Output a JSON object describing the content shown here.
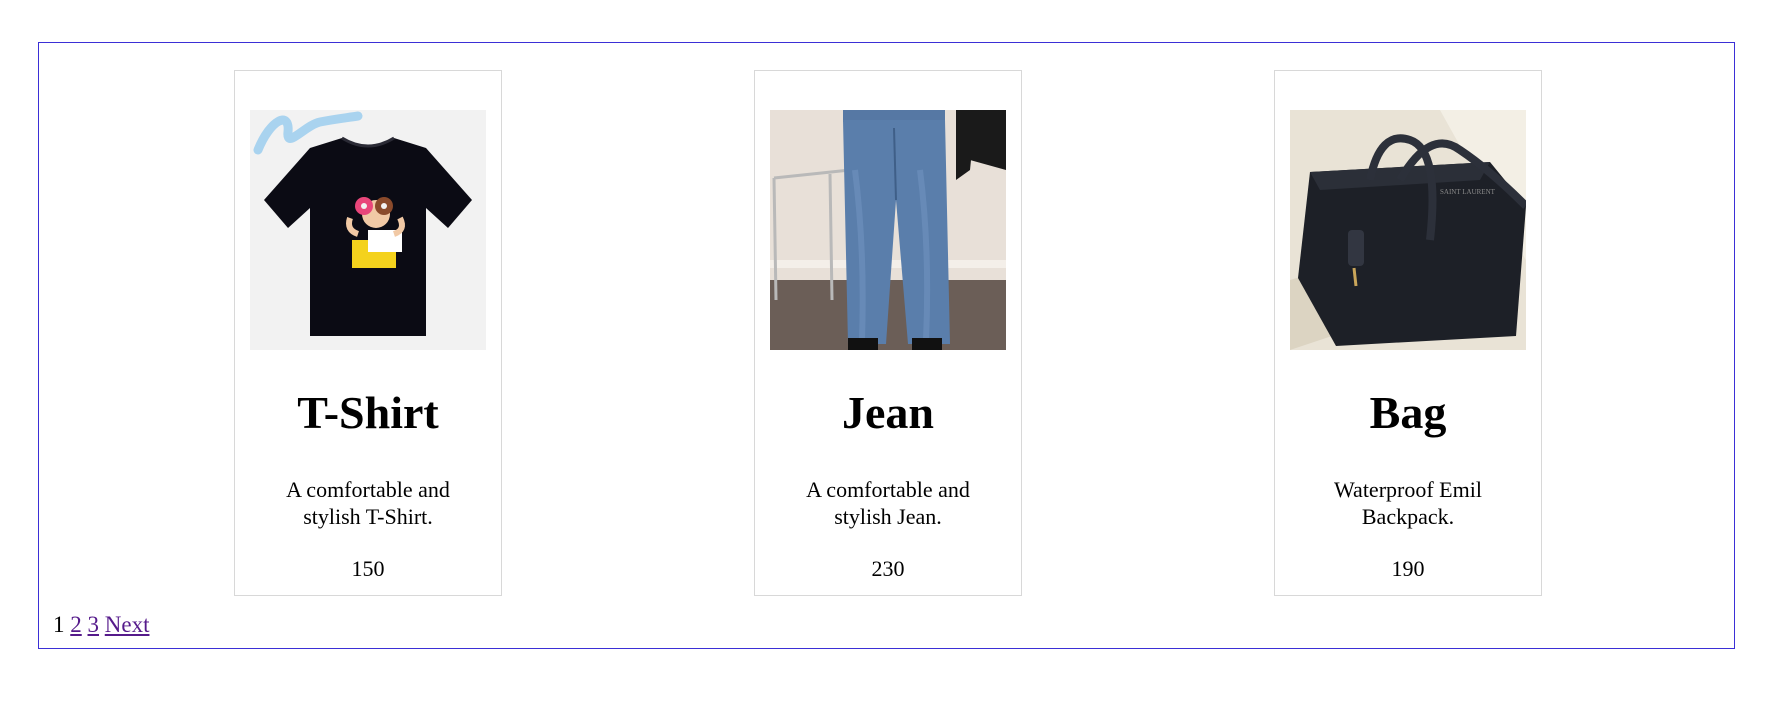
{
  "products": [
    {
      "name": "T-Shirt",
      "description": "A comfortable and stylish T-Shirt.",
      "price": "150",
      "image_icon": "tshirt-image"
    },
    {
      "name": "Jean",
      "description": "A comfortable and stylish Jean.",
      "price": "230",
      "image_icon": "jeans-image"
    },
    {
      "name": "Bag",
      "description": "Waterproof Emil Backpack.",
      "price": "190",
      "image_icon": "bag-image"
    }
  ],
  "pagination": {
    "current": "1",
    "pages": [
      "2",
      "3"
    ],
    "next_label": "Next"
  },
  "colors": {
    "frame_border": "#3b2fd6",
    "card_border": "#d8d8d8",
    "link": "#551a8b"
  }
}
